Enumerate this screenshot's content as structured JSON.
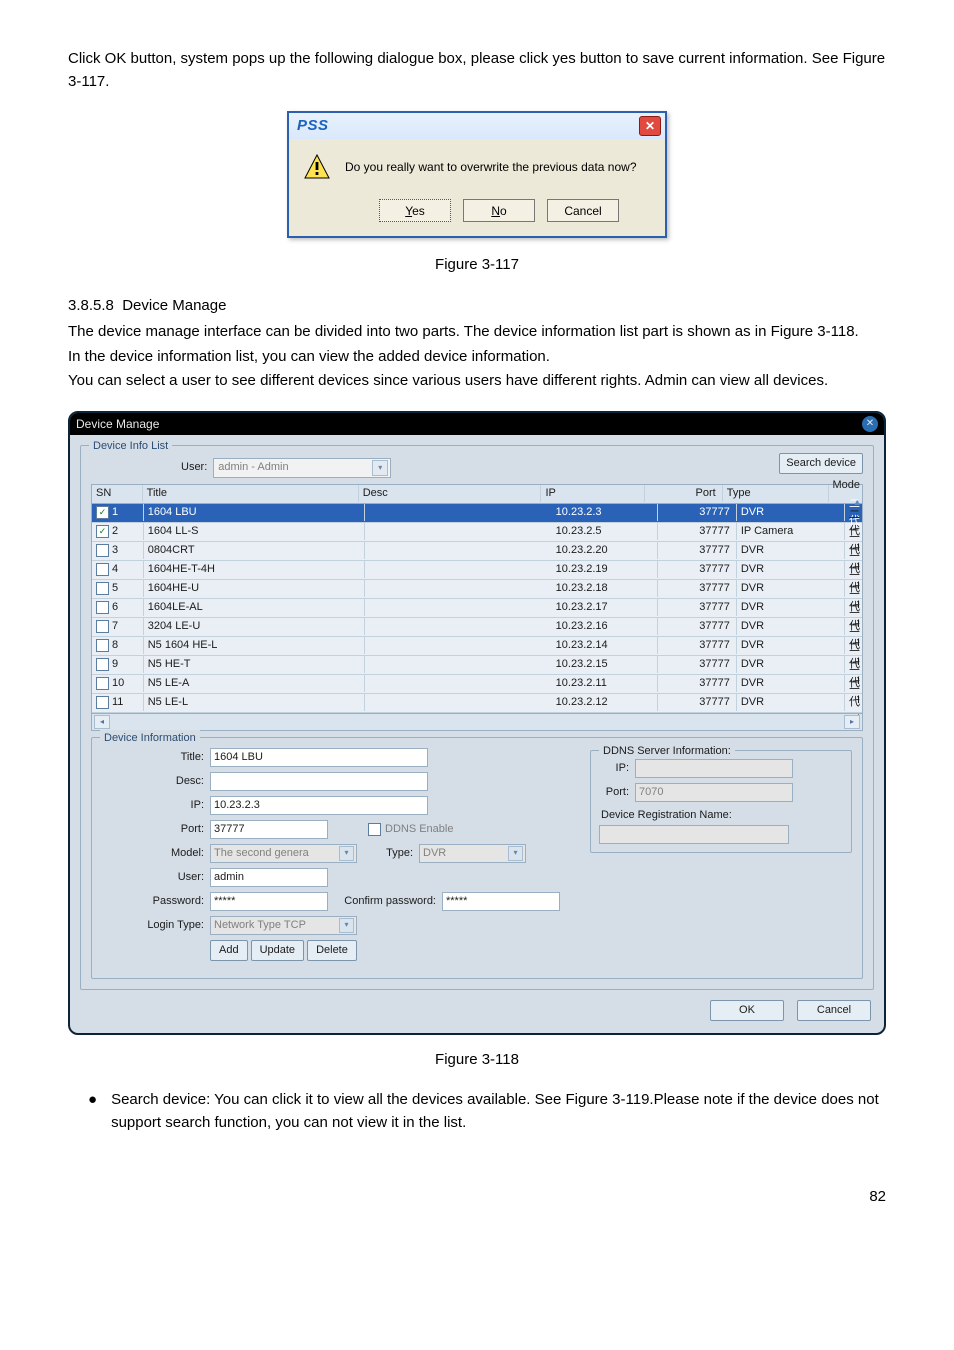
{
  "intro_para": "Click OK button, system pops up the following dialogue box, please click yes button to save current information. See Figure 3-117.",
  "dialog": {
    "app": "PSS",
    "message": "Do you really want to overwrite the previous data now?",
    "yes": "Yes",
    "no": "No",
    "cancel": "Cancel"
  },
  "fig117": "Figure 3-117",
  "section_no": "3.8.5.8",
  "section_title": "Device Manage",
  "para2": "The device manage interface can be divided into two parts. The device information list part is shown as in Figure 3-118.",
  "para3": "In the device information list, you can view the added device information.",
  "para4": "You can select a user to see different devices since various users have different rights. Admin can view all devices.",
  "dm": {
    "title": "Device Manage",
    "legend": "Device Info List",
    "user_label": "User:",
    "user_value": "admin - Admin",
    "search_btn": "Search device",
    "columns": {
      "sn": "SN",
      "title": "Title",
      "desc": "Desc",
      "ip": "IP",
      "port": "Port",
      "type": "Type",
      "mode": "Mode"
    },
    "rows": [
      {
        "sn": "1",
        "checked": true,
        "selected": true,
        "title": "1604 LBU",
        "ip": "10.23.2.3",
        "port": "37777",
        "type": "DVR",
        "mode": "二代"
      },
      {
        "sn": "2",
        "checked": true,
        "selected": false,
        "title": "1604 LL-S",
        "ip": "10.23.2.5",
        "port": "37777",
        "type": "IP Camera",
        "mode": "二代I"
      },
      {
        "sn": "3",
        "checked": false,
        "selected": false,
        "title": "0804CRT",
        "ip": "10.23.2.20",
        "port": "37777",
        "type": "DVR",
        "mode": "二代I"
      },
      {
        "sn": "4",
        "checked": false,
        "selected": false,
        "title": "1604HE-T-4H",
        "ip": "10.23.2.19",
        "port": "37777",
        "type": "DVR",
        "mode": "二代I"
      },
      {
        "sn": "5",
        "checked": false,
        "selected": false,
        "title": "1604HE-U",
        "ip": "10.23.2.18",
        "port": "37777",
        "type": "DVR",
        "mode": "二代I"
      },
      {
        "sn": "6",
        "checked": false,
        "selected": false,
        "title": "1604LE-AL",
        "ip": "10.23.2.17",
        "port": "37777",
        "type": "DVR",
        "mode": "二代I"
      },
      {
        "sn": "7",
        "checked": false,
        "selected": false,
        "title": "3204 LE-U",
        "ip": "10.23.2.16",
        "port": "37777",
        "type": "DVR",
        "mode": "二代I"
      },
      {
        "sn": "8",
        "checked": false,
        "selected": false,
        "title": "N5 1604 HE-L",
        "ip": "10.23.2.14",
        "port": "37777",
        "type": "DVR",
        "mode": "二代I"
      },
      {
        "sn": "9",
        "checked": false,
        "selected": false,
        "title": "N5 HE-T",
        "ip": "10.23.2.15",
        "port": "37777",
        "type": "DVR",
        "mode": "二代I"
      },
      {
        "sn": "10",
        "checked": false,
        "selected": false,
        "title": "N5 LE-A",
        "ip": "10.23.2.11",
        "port": "37777",
        "type": "DVR",
        "mode": "二代I"
      },
      {
        "sn": "11",
        "checked": false,
        "selected": false,
        "title": "N5 LE-L",
        "ip": "10.23.2.12",
        "port": "37777",
        "type": "DVR",
        "mode": "二代I"
      }
    ],
    "devinfo_legend": "Device Information",
    "fields": {
      "title_l": "Title:",
      "title_v": "1604 LBU",
      "desc_l": "Desc:",
      "desc_v": "",
      "ip_l": "IP:",
      "ip_v": "10.23.2.3",
      "port_l": "Port:",
      "port_v": "37777",
      "model_l": "Model:",
      "model_v": "The second genera",
      "user_l": "User:",
      "user_v": "admin",
      "pwd_l": "Password:",
      "pwd_v": "*****",
      "cpwd_l": "Confirm password:",
      "cpwd_v": "*****",
      "login_l": "Login Type:",
      "login_v": "Network Type TCP",
      "ddns_enable": "DDNS Enable",
      "type_l": "Type:",
      "type_v": "DVR"
    },
    "ddns": {
      "legend": "DDNS Server Information:",
      "ip_l": "IP:",
      "ip_v": "",
      "port_l": "Port:",
      "port_v": "7070",
      "reg_l": "Device Registration Name:",
      "reg_v": ""
    },
    "btns": {
      "add": "Add",
      "update": "Update",
      "delete": "Delete",
      "ok": "OK",
      "cancel": "Cancel"
    }
  },
  "fig118": "Figure 3-118",
  "bullet": "Search device: You can click it to view all the devices available. See Figure 3-119.Please note if the device does not support search function, you can not view it in the list.",
  "page_num": "82"
}
